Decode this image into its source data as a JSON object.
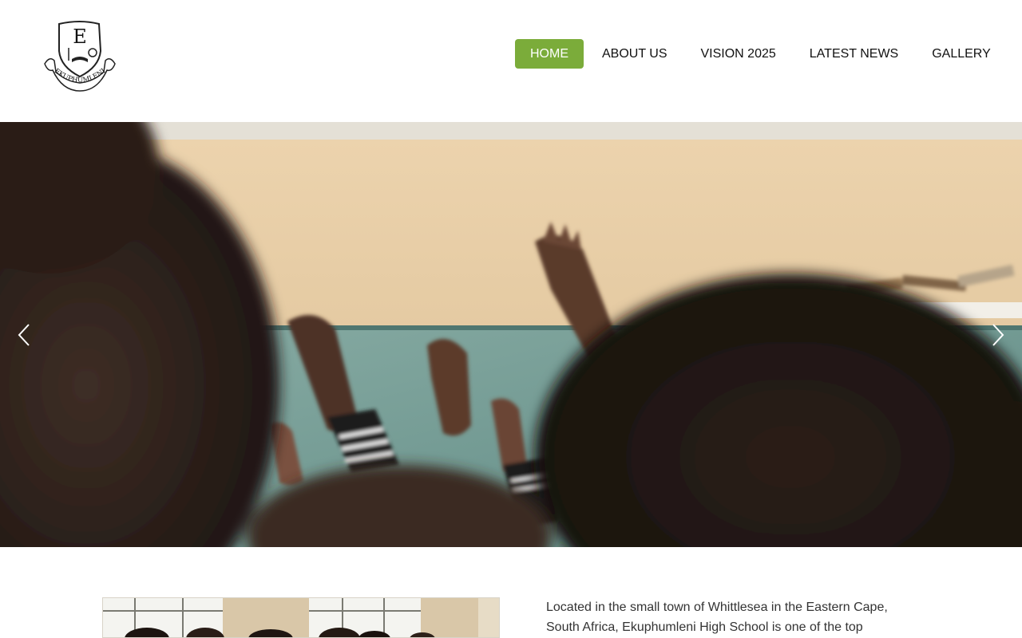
{
  "brand": {
    "logo_icon": "school-crest-icon",
    "logo_initial": "E",
    "logo_banner": "EKUPHUMLENI",
    "accent_color": "#7bac3a"
  },
  "nav": {
    "items": [
      {
        "label": "HOME",
        "active": true
      },
      {
        "label": "ABOUT US",
        "active": false
      },
      {
        "label": "VISION 2025",
        "active": false
      },
      {
        "label": "LATEST NEWS",
        "active": false
      },
      {
        "label": "GALLERY",
        "active": false
      }
    ]
  },
  "hero": {
    "photo_subject": "students raising hands in classroom",
    "prev_icon": "chevron-left-icon",
    "next_icon": "chevron-right-icon"
  },
  "intro": {
    "text": "Located in the small town of Whittlesea in the Eastern Cape, South Africa, Ekuphumleni High School is one of the top"
  }
}
